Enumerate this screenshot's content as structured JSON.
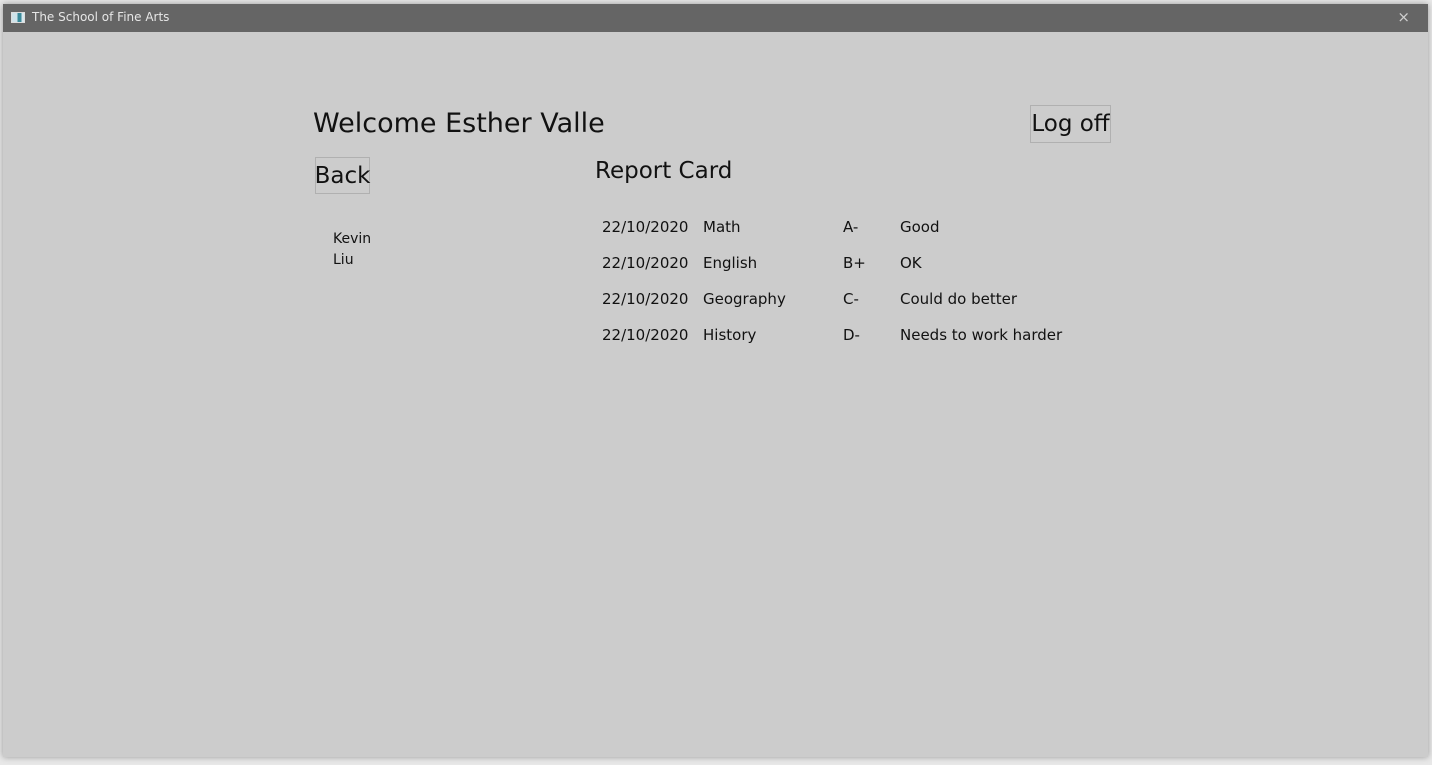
{
  "window": {
    "title": "The School of Fine Arts",
    "icon": "app-window-icon",
    "close_icon": "close-icon",
    "close_label": "×"
  },
  "header": {
    "welcome": "Welcome Esther Valle",
    "logoff_label": "Log off"
  },
  "nav": {
    "back_label": "Back"
  },
  "student": {
    "first_name": "Kevin",
    "last_name": "Liu"
  },
  "report": {
    "title": "Report Card",
    "rows": [
      {
        "date": "22/10/2020",
        "subject": "Math",
        "grade": "A-",
        "comment": "Good"
      },
      {
        "date": "22/10/2020",
        "subject": "English",
        "grade": "B+",
        "comment": "OK"
      },
      {
        "date": "22/10/2020",
        "subject": "Geography",
        "grade": "C-",
        "comment": "Could do better"
      },
      {
        "date": "22/10/2020",
        "subject": "History",
        "grade": "D-",
        "comment": "Needs to work harder"
      }
    ]
  },
  "colors": {
    "titlebar": "#656565",
    "background": "#cccccc"
  }
}
